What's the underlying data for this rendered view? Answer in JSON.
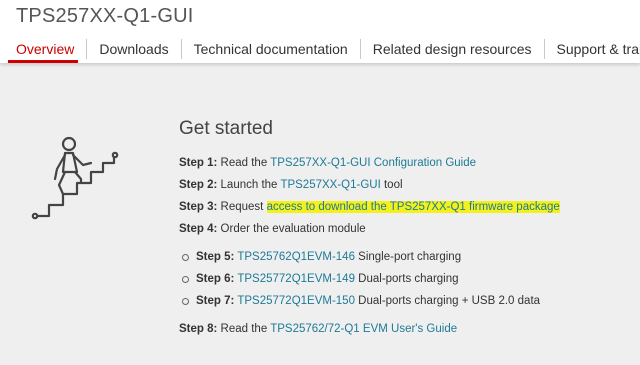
{
  "header": {
    "title": "TPS257XX-Q1-GUI",
    "tabs": [
      {
        "label": "Overview",
        "active": true
      },
      {
        "label": "Downloads"
      },
      {
        "label": "Technical documentation"
      },
      {
        "label": "Related design resources"
      },
      {
        "label": "Support & training"
      }
    ]
  },
  "colors": {
    "accent": "#cc0000",
    "link": "#1e7a96",
    "highlight": "#f4f01c"
  },
  "main": {
    "illustration_icon": "person-climbing-stairs-icon",
    "heading": "Get started",
    "step1": {
      "label": "Step 1:",
      "pre": " Read the ",
      "link": "TPS257XX-Q1-GUI Configuration Guide"
    },
    "step2": {
      "label": "Step 2:",
      "pre": " Launch the ",
      "link": "TPS257XX-Q1-GUI",
      "post": " tool"
    },
    "step3": {
      "label": "Step 3:",
      "pre": " Request ",
      "link": "access to download the TPS257XX-Q1 firmware package"
    },
    "step4": {
      "label": "Step 4:",
      "text": " Order the evaluation module"
    },
    "step5": {
      "label": "Step 5:",
      "link": "TPS25762Q1EVM-146",
      "post": " Single-port charging"
    },
    "step6": {
      "label": "Step 6:",
      "link": "TPS25772Q1EVM-149",
      "post": " Dual-ports charging"
    },
    "step7": {
      "label": "Step 7:",
      "link": "TPS25772Q1EVM-150",
      "post": " Dual-ports charging + USB 2.0 data"
    },
    "step8": {
      "label": "Step 8:",
      "pre": " Read the ",
      "link": "TPS25762/72-Q1 EVM User's Guide"
    }
  }
}
